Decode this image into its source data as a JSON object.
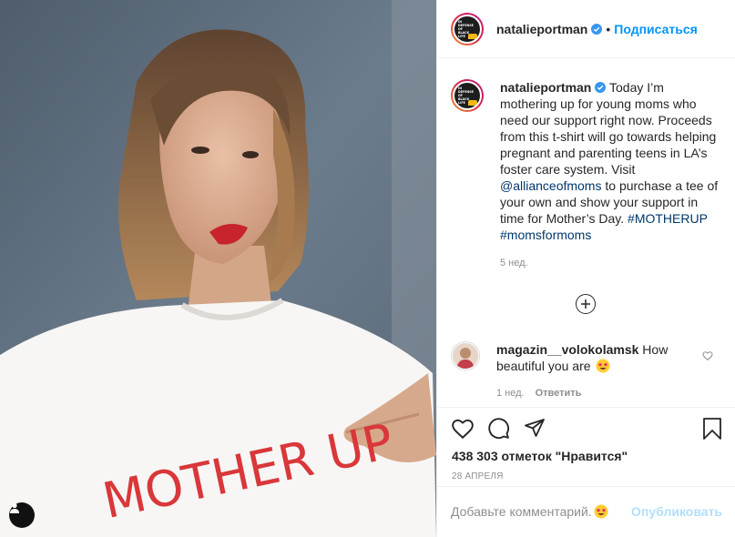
{
  "header": {
    "username": "natalieportman",
    "separator": "•",
    "follow_label": "Подписаться",
    "avatar_text": [
      "IN",
      "DEFENSE",
      "OF",
      "BLACK",
      "LIFE"
    ]
  },
  "photo": {
    "shirt_text": "MOTHER UP",
    "tag_icon": "user-icon"
  },
  "caption": {
    "username": "natalieportman",
    "text_1": " Today I’m mothering up for young moms who need our support right now. Proceeds from this t-shirt will go towards helping pregnant and parenting teens in LA’s foster care system. Visit ",
    "mention": "@allianceofmoms",
    "text_2": " to purchase a tee of your own and show your support in time for Mother’s Day. ",
    "hashtag_1": "#MOTHERUP",
    "hashtag_2": "#momsformoms",
    "time": "5 нед."
  },
  "comment": {
    "username": "magazin__volokolamsk",
    "text": " How beautiful you are ",
    "emoji": "star-struck-emoji",
    "time": "1 нед.",
    "reply_label": "Ответить"
  },
  "actions": {
    "likes": "438 303 отметок \"Нравится\"",
    "date": "28 АПРЕЛЯ"
  },
  "add_comment": {
    "placeholder": "Добавьте комментарий...",
    "publish_label": "Опубликовать"
  },
  "colors": {
    "accent": "#0095f6",
    "link": "#00376b",
    "muted": "#8e8e8e",
    "publish_disabled": "#b2dffc",
    "shirt_text": "#d9373a"
  }
}
